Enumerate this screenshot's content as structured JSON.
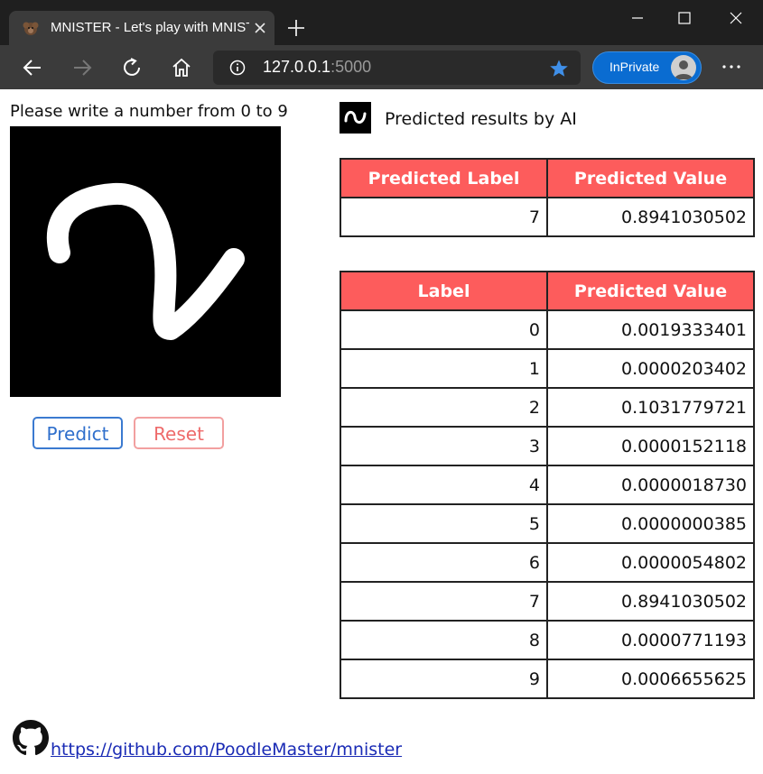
{
  "browser": {
    "tab_title": "MNISTER - Let's play with MNIST",
    "url_host": "127.0.0.1",
    "url_port": ":5000",
    "inprivate_label": "InPrivate"
  },
  "left": {
    "instruction": "Please write a number from 0 to 9",
    "predict_label": "Predict",
    "reset_label": "Reset"
  },
  "right": {
    "heading": "Predicted results by AI",
    "top_table": {
      "headers": [
        "Predicted Label",
        "Predicted Value"
      ],
      "row": [
        "7",
        "0.8941030502"
      ]
    },
    "all_table": {
      "headers": [
        "Label",
        "Predicted Value"
      ],
      "rows": [
        [
          "0",
          "0.0019333401"
        ],
        [
          "1",
          "0.0000203402"
        ],
        [
          "2",
          "0.1031779721"
        ],
        [
          "3",
          "0.0000152118"
        ],
        [
          "4",
          "0.0000018730"
        ],
        [
          "5",
          "0.0000000385"
        ],
        [
          "6",
          "0.0000054802"
        ],
        [
          "7",
          "0.8941030502"
        ],
        [
          "8",
          "0.0000771193"
        ],
        [
          "9",
          "0.0006655625"
        ]
      ]
    }
  },
  "footer": {
    "link_text": " https://github.com/PoodleMaster/mnister"
  },
  "colors": {
    "header_bg": "#fd5c5c",
    "predict_border": "#3b7ad0",
    "reset_border": "#f2a0a0",
    "link": "#1a2bb5"
  },
  "icons": [
    "poodle-favicon-icon",
    "close-icon",
    "plus-icon",
    "minimize-icon",
    "maximize-icon",
    "window-close-icon",
    "back-arrow-icon",
    "forward-arrow-icon",
    "refresh-icon",
    "home-icon",
    "info-icon",
    "star-icon",
    "avatar-icon",
    "more-icon",
    "ai-logo-icon",
    "github-icon"
  ]
}
